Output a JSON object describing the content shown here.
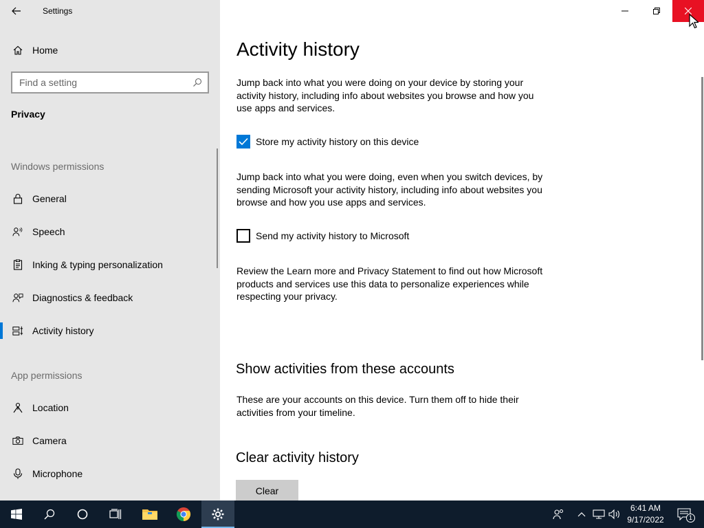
{
  "window": {
    "title": "Settings",
    "back_icon": "back-arrow-icon",
    "minimize_icon": "minimize-icon",
    "maximize_icon": "restore-icon",
    "close_icon": "close-icon",
    "close_color": "#e81123"
  },
  "sidebar": {
    "home_label": "Home",
    "search_placeholder": "Find a setting",
    "section_title": "Privacy",
    "windows_permissions_label": "Windows permissions",
    "app_permissions_label": "App permissions",
    "windows_items": [
      {
        "label": "General",
        "icon": "lock-icon"
      },
      {
        "label": "Speech",
        "icon": "speech-icon"
      },
      {
        "label": "Inking & typing personalization",
        "icon": "clipboard-icon"
      },
      {
        "label": "Diagnostics & feedback",
        "icon": "feedback-icon"
      },
      {
        "label": "Activity history",
        "icon": "timeline-icon",
        "active": true
      }
    ],
    "app_items": [
      {
        "label": "Location",
        "icon": "location-icon"
      },
      {
        "label": "Camera",
        "icon": "camera-icon"
      },
      {
        "label": "Microphone",
        "icon": "microphone-icon"
      }
    ],
    "accent_color": "#0078d7"
  },
  "main": {
    "title": "Activity history",
    "intro": "Jump back into what you were doing on your device by storing your activity history, including info about websites you browse and how you use apps and services.",
    "store_checkbox": {
      "label": "Store my activity history on this device",
      "checked": true
    },
    "sync_text": "Jump back into what you were doing, even when you switch devices, by sending Microsoft your activity history, including info about websites you browse and how you use apps and services.",
    "send_checkbox": {
      "label": "Send my activity history to Microsoft",
      "checked": false
    },
    "review_text": "Review the Learn more and Privacy Statement to find out how Microsoft products and services use this data to personalize experiences while respecting your privacy.",
    "accounts_heading": "Show activities from these accounts",
    "accounts_text": "These are your accounts on this device. Turn them off to hide their activities from your timeline.",
    "clear_heading": "Clear activity history",
    "clear_button": "Clear"
  },
  "taskbar": {
    "apps": [
      {
        "name": "start",
        "icon": "windows-logo-icon"
      },
      {
        "name": "search",
        "icon": "search-icon"
      },
      {
        "name": "cortana",
        "icon": "cortana-circle-icon"
      },
      {
        "name": "task-view",
        "icon": "task-view-icon"
      },
      {
        "name": "file-explorer",
        "icon": "folder-icon"
      },
      {
        "name": "chrome",
        "icon": "chrome-icon"
      },
      {
        "name": "settings",
        "icon": "gear-icon",
        "active": true
      }
    ],
    "time": "6:41 AM",
    "date": "9/17/2022",
    "notification_count": "1"
  }
}
